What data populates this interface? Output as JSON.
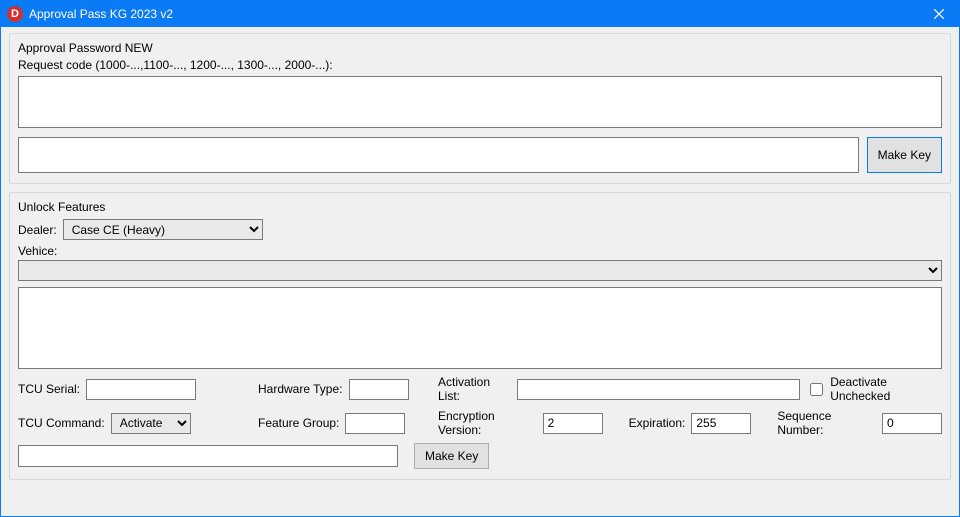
{
  "titlebar": {
    "icon_letter": "D",
    "title": "Approval Pass KG 2023 v2"
  },
  "approval": {
    "group_title": "Approval Password NEW",
    "request_label": "Request code (1000-...,1100-..., 1200-..., 1300-..., 2000-...):",
    "request_value": "",
    "result_value": "",
    "make_key_label": "Make Key"
  },
  "unlock": {
    "group_title": "Unlock Features",
    "dealer_label": "Dealer:",
    "dealer_value": "Case CE (Heavy)",
    "vehicle_label": "Vehice:",
    "vehicle_value": "",
    "tcu_serial_label": "TCU Serial:",
    "tcu_serial_value": "",
    "hardware_type_label": "Hardware Type:",
    "hardware_type_value": "",
    "activation_list_label": "Activation List:",
    "activation_list_value": "",
    "deactivate_label": "Deactivate Unchecked",
    "tcu_command_label": "TCU Command:",
    "tcu_command_value": "Activate",
    "feature_group_label": "Feature Group:",
    "feature_group_value": "",
    "encryption_label": "Encryption Version:",
    "encryption_value": "2",
    "expiration_label": "Expiration:",
    "expiration_value": "255",
    "sequence_label": "Sequence Number:",
    "sequence_value": "0",
    "make_key_label": "Make Key",
    "output_value": ""
  }
}
